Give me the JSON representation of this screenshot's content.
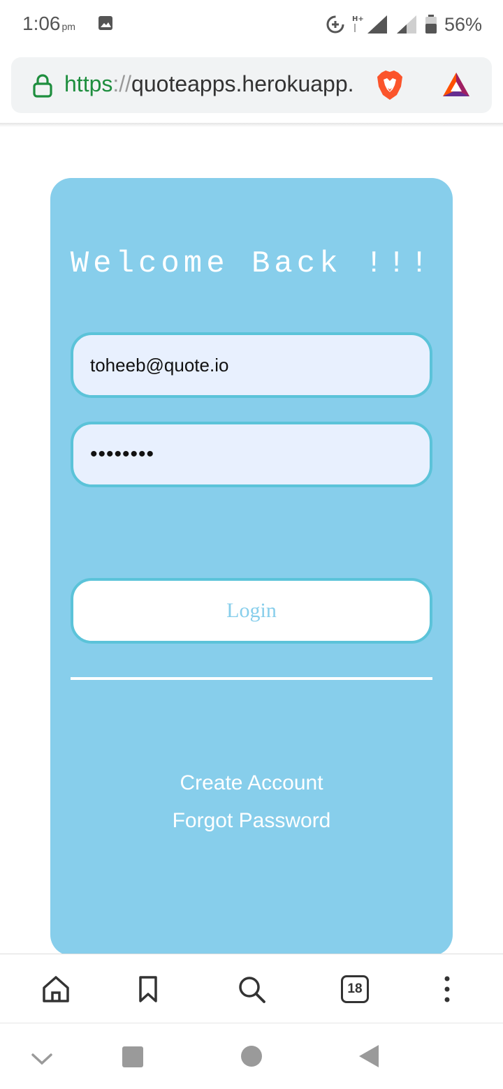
{
  "status_bar": {
    "time": "1:06",
    "ampm": "pm",
    "network_label": "H+",
    "battery": "56%"
  },
  "browser": {
    "url_scheme": "https",
    "url_separator": "://",
    "url_host": "quoteapps.herokuapp.",
    "brand_icon": "brave-lion-icon",
    "rewards_icon": "bat-triangle-icon",
    "tabs_count": "18"
  },
  "login_card": {
    "title": "Welcome Back !!!",
    "email_value": "toheeb@quote.io",
    "password_value": "••••••••",
    "login_label": "Login",
    "create_account_label": "Create Account",
    "forgot_password_label": "Forgot Password"
  },
  "colors": {
    "card_bg": "#87ceeb",
    "field_bg": "#e8f0fe",
    "field_border": "#5bc3d9",
    "secure_green": "#1e8e3e"
  }
}
